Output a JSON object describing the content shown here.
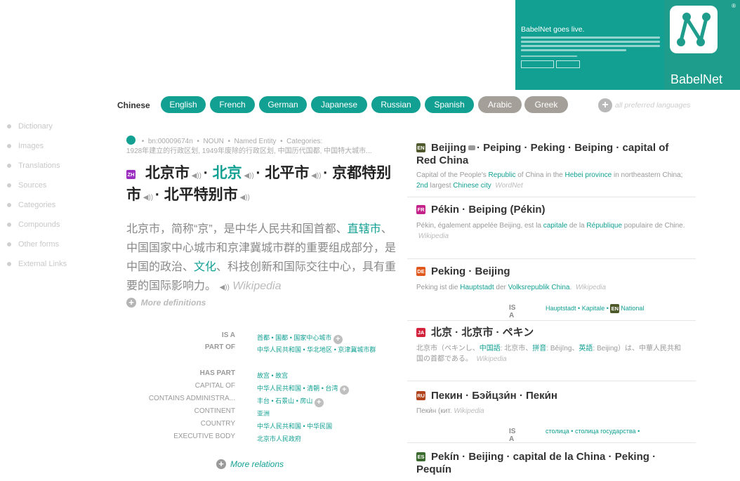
{
  "promo": {
    "title": "BabelNet goes live.",
    "logo_name": "BabelNet",
    "registered": "®"
  },
  "languages": {
    "current": "Chinese",
    "tabs": [
      {
        "label": "English",
        "active": true
      },
      {
        "label": "French",
        "active": true
      },
      {
        "label": "German",
        "active": true
      },
      {
        "label": "Japanese",
        "active": true
      },
      {
        "label": "Russian",
        "active": true
      },
      {
        "label": "Spanish",
        "active": true
      },
      {
        "label": "Arabic",
        "active": false
      },
      {
        "label": "Greek",
        "active": false
      }
    ],
    "all_preferred": "all preferred languages"
  },
  "sidebar": {
    "items": [
      "Dictionary",
      "Images",
      "Translations",
      "Sources",
      "Categories",
      "Compounds",
      "Other forms",
      "External Links"
    ]
  },
  "synset": {
    "meta_id": "bn:00009674n",
    "meta_pos": "NOUN",
    "meta_type": "Named Entity",
    "meta_categories_label": "Categories:",
    "meta_categories": "1928年建立的行政区划, 1949年废除的行政区划, 中国历代国都, 中国特大城市...",
    "lang_badge": "ZH",
    "lemmas": [
      {
        "text": "北京市",
        "highlight": false
      },
      {
        "text": "北京",
        "highlight": true
      },
      {
        "text": "北平市",
        "highlight": false
      },
      {
        "text": "京都特别市",
        "highlight": false
      },
      {
        "text": "北平特别市",
        "highlight": false
      }
    ],
    "definition_parts": [
      {
        "text": "北京市，简称“京”，是中华人民共和国首都、",
        "link": false
      },
      {
        "text": "直辖市",
        "link": true
      },
      {
        "text": "、中国国家中心城市和京津冀城市群的重要组成部分，是中国的政治、",
        "link": false
      },
      {
        "text": "文化",
        "link": true
      },
      {
        "text": "、科技创新和国际交往中心，具有重要的国际影响力。",
        "link": false
      }
    ],
    "definition_source": "Wikipedia",
    "more_definitions": "More definitions",
    "more_relations": "More relations"
  },
  "relations": [
    {
      "key": "IS A",
      "bold": true,
      "values": [
        "首都",
        "国都",
        "国家中心城市"
      ],
      "more": true
    },
    {
      "key": "PART OF",
      "bold": true,
      "values": [
        "中华人民共和国",
        "华北地区",
        "京津冀城市群"
      ],
      "more": false
    },
    {
      "key": "HAS PART",
      "bold": true,
      "values": [
        "故宫",
        "故宫"
      ],
      "more": false
    },
    {
      "key": "CAPITAL OF",
      "bold": false,
      "values": [
        "中华人民共和国",
        "清朝",
        "台湾"
      ],
      "more": true
    },
    {
      "key": "CONTAINS ADMINISTRA...",
      "bold": false,
      "values": [
        "丰台",
        "石景山",
        "房山"
      ],
      "more": true
    },
    {
      "key": "CONTINENT",
      "bold": false,
      "values": [
        "亚洲"
      ],
      "more": false
    },
    {
      "key": "COUNTRY",
      "bold": false,
      "values": [
        "中华人民共和国",
        "中华民国"
      ],
      "more": false
    },
    {
      "key": "EXECUTIVE BODY",
      "bold": false,
      "values": [
        "北京市人民政府"
      ],
      "more": false
    }
  ],
  "entries": {
    "en": {
      "badge": "EN",
      "title_a": "Beijing",
      "title_b": "· Peiping · Peking · Beiping · capital of Red China",
      "desc": [
        {
          "t": "Capital of the People's ",
          "l": false
        },
        {
          "t": "Republic",
          "l": true
        },
        {
          "t": " of China in the ",
          "l": false
        },
        {
          "t": "Hebei province",
          "l": true
        },
        {
          "t": " in northeastern China; ",
          "l": false
        },
        {
          "t": "2nd",
          "l": true
        },
        {
          "t": " largest ",
          "l": false
        },
        {
          "t": "Chinese city",
          "l": true
        }
      ],
      "source": "WordNet"
    },
    "fr": {
      "badge": "FR",
      "title": "Pékin · Beiping (Pékin)",
      "desc": [
        {
          "t": "Pékin, également appelée Beijing, est la ",
          "l": false
        },
        {
          "t": "capitale",
          "l": true
        },
        {
          "t": " de la ",
          "l": false
        },
        {
          "t": "République",
          "l": true
        },
        {
          "t": " populaire de Chine.",
          "l": false
        }
      ],
      "source": "Wikipedia"
    },
    "de": {
      "badge": "DE",
      "title": "Peking · Beijing",
      "desc": [
        {
          "t": "Peking ist die ",
          "l": false
        },
        {
          "t": "Hauptstadt",
          "l": true
        },
        {
          "t": " der ",
          "l": false
        },
        {
          "t": "Volksrepublik China",
          "l": true
        },
        {
          "t": ".",
          "l": false
        }
      ],
      "source": "Wikipedia",
      "isa_key": "IS A",
      "isa_values": [
        "Hauptstadt",
        "Kapitale"
      ],
      "isa_last_badge": "EN",
      "isa_last": "National"
    },
    "ja": {
      "badge": "JA",
      "title": "北京 · 北京市 · ペキン",
      "desc": [
        {
          "t": "北京市（ペキンし、",
          "l": false
        },
        {
          "t": "中国語",
          "l": true
        },
        {
          "t": ": 北京市、",
          "l": false
        },
        {
          "t": "拼音",
          "l": true
        },
        {
          "t": ": Běijīng、",
          "l": false
        },
        {
          "t": "英語",
          "l": true
        },
        {
          "t": ": Beijing）は、中華人民共和国の首都である。",
          "l": false
        }
      ],
      "source": "Wikipedia"
    },
    "ru": {
      "badge": "RU",
      "title": "Пекин · Бэйцзи́н · Пеки́н",
      "desc": [
        {
          "t": "Пеки́н (кит.",
          "l": false
        }
      ],
      "source": "Wikipedia",
      "isa_key": "IS A",
      "isa_values": [
        "столица",
        "столица государства"
      ]
    },
    "es": {
      "badge": "ES",
      "title": "Pekín · Beijing · capital de la China · Peking · Pequín"
    }
  }
}
